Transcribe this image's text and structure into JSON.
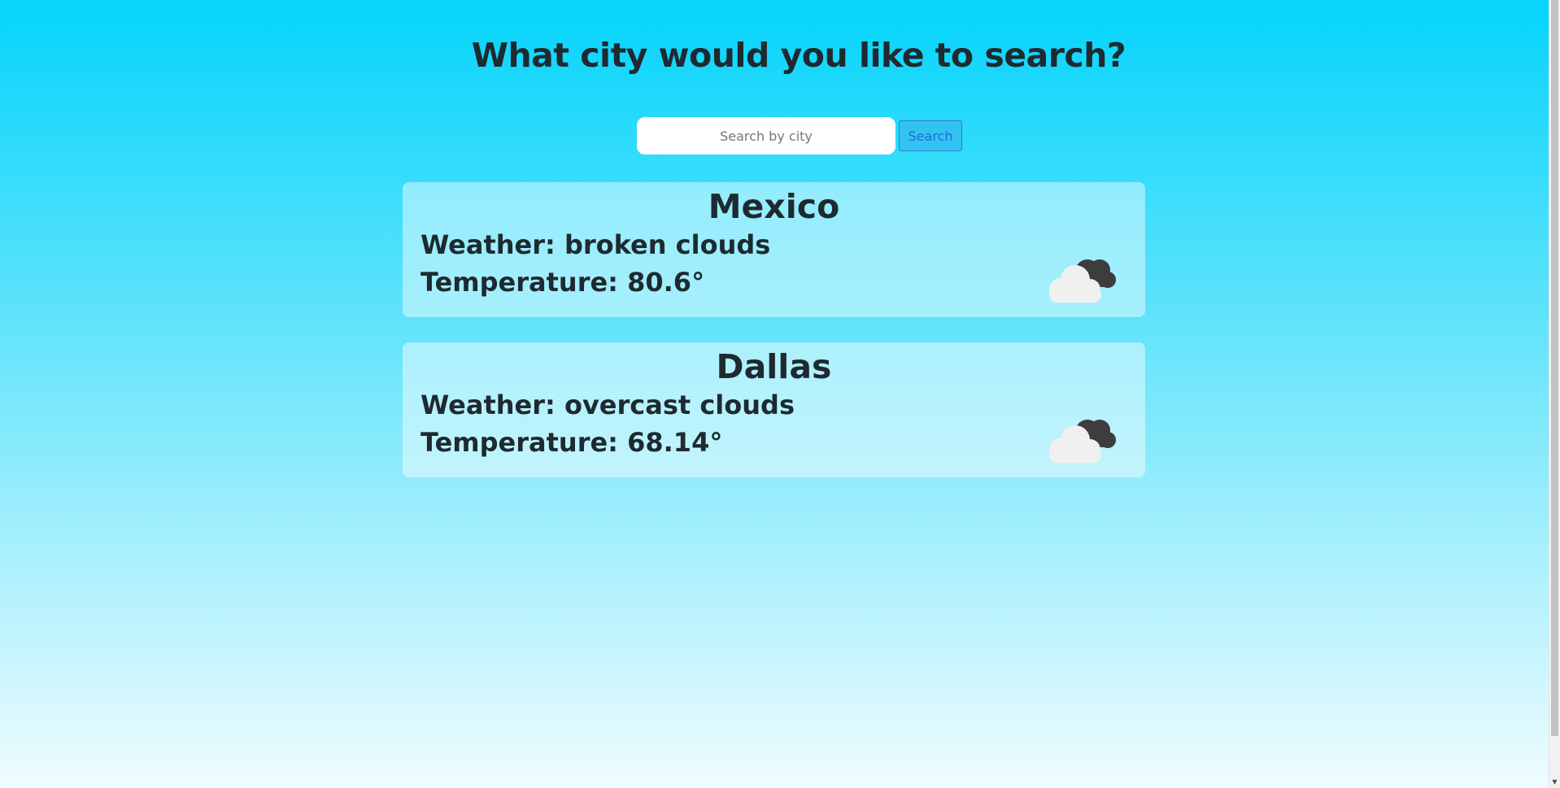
{
  "heading": "What city would you like to search?",
  "search": {
    "placeholder": "Search by city",
    "value": "",
    "button_label": "Search"
  },
  "cards": [
    {
      "city": "Mexico",
      "weather_label": "Weather: ",
      "weather": "broken clouds",
      "temp_label": "Temperature: ",
      "temp": "80.6°",
      "icon": "broken-clouds-icon"
    },
    {
      "city": "Dallas",
      "weather_label": "Weather: ",
      "weather": "overcast clouds",
      "temp_label": "Temperature: ",
      "temp": "68.14°",
      "icon": "overcast-clouds-icon"
    }
  ],
  "colors": {
    "background_top": "#05d4fb",
    "background_bottom": "#effcff",
    "text": "#1e2a30",
    "button_text": "#1a6fd8"
  }
}
